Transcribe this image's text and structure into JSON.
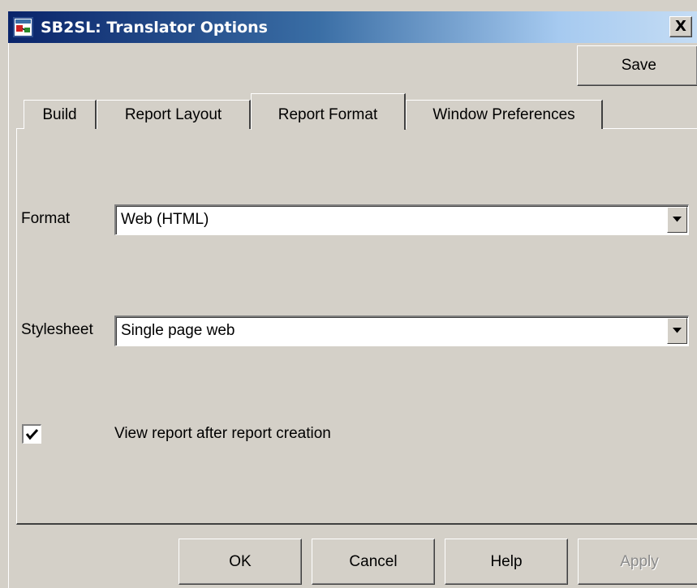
{
  "window": {
    "title": "SB2SL: Translator Options",
    "close_label": "X"
  },
  "toolbar": {
    "save_label": "Save"
  },
  "tabs": [
    {
      "label": "Build",
      "selected": false
    },
    {
      "label": "Report Layout",
      "selected": false
    },
    {
      "label": "Report Format",
      "selected": true
    },
    {
      "label": "Window Preferences",
      "selected": false
    }
  ],
  "form": {
    "format_label": "Format",
    "format_value": "Web (HTML)",
    "stylesheet_label": "Stylesheet",
    "stylesheet_value": "Single page web",
    "view_report_label": "View report after report creation",
    "view_report_checked": true
  },
  "buttons": {
    "ok": "OK",
    "cancel": "Cancel",
    "help": "Help",
    "apply": "Apply"
  },
  "icons": {
    "app": "simulink-app-icon",
    "close": "close-icon",
    "dropdown": "chevron-down-icon",
    "check": "checkmark-icon"
  }
}
